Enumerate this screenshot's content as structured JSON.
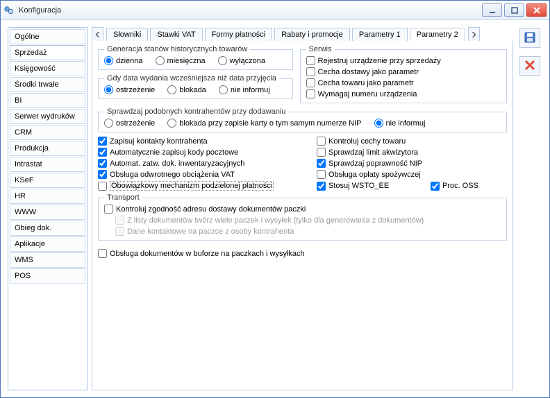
{
  "window": {
    "title": "Konfiguracja"
  },
  "sidebar": {
    "items": [
      {
        "label": "Ogólne"
      },
      {
        "label": "Sprzedaż",
        "selected": true
      },
      {
        "label": "Księgowość"
      },
      {
        "label": "Środki trwałe"
      },
      {
        "label": "BI"
      },
      {
        "label": "Serwer wydruków"
      },
      {
        "label": "CRM"
      },
      {
        "label": "Produkcja"
      },
      {
        "label": "Intrastat"
      },
      {
        "label": "KSeF"
      },
      {
        "label": "HR"
      },
      {
        "label": "WWW"
      },
      {
        "label": "Obieg dok."
      },
      {
        "label": "Aplikacje"
      },
      {
        "label": "WMS"
      },
      {
        "label": "POS"
      }
    ]
  },
  "tabs": [
    {
      "label": "Słowniki"
    },
    {
      "label": "Stawki VAT"
    },
    {
      "label": "Formy płatności"
    },
    {
      "label": "Rabaty i promocje"
    },
    {
      "label": "Parametry 1"
    },
    {
      "label": "Parametry 2",
      "active": true
    }
  ],
  "gen": {
    "legend": "Generacja stanów historycznych towarów",
    "opt1": "dzienna",
    "opt2": "miesięczna",
    "opt3": "wyłączona"
  },
  "serwis": {
    "legend": "Serwis",
    "c1": "Rejestruj urządzenie przy sprzedaży",
    "c2": "Cecha dostawy jako parametr",
    "c3": "Cecha towaru jako parametr",
    "c4": "Wymagaj numeru urządzenia"
  },
  "gdy": {
    "legend": "Gdy data wydania wcześniejsza niż data przyjęcia",
    "opt1": "ostrzeżenie",
    "opt2": "blokada",
    "opt3": "nie informuj"
  },
  "spr": {
    "legend": "Sprawdzaj podobnych kontrahentów przy dodawaniu",
    "opt1": "ostrzeżenie",
    "opt2": "blokada przy zapisie karty o tym samym numerze NIP",
    "opt3": "nie informuj"
  },
  "c": {
    "a1": "Zapisuj kontakty kontrahenta",
    "a2": "Automatycznie zapisuj kody pocztowe",
    "a3": "Automat. zatw. dok. inwentaryzacyjnych",
    "a4": "Obsługa odwrotnego obciążenia VAT",
    "a5": "Obowiązkowy mechanizm podzielonej płatności",
    "b1": "Kontroluj cechy towaru",
    "b2": "Sprawdzaj limit akwizytora",
    "b3": "Sprawdzaj poprawność NIP",
    "b4": "Obsługa opłaty spożywczej",
    "b5": "Stosuj WSTO_EE",
    "b6": "Proc. OSS"
  },
  "transport": {
    "legend": "Transport",
    "c1": "Kontroluj zgodność adresu dostawy dokumentów paczki",
    "c2": "Z listy dokumentów twórz wiele paczek i wysyłek (tylko dla generowania z dokumentów)",
    "c3": "Dane kontaktowe na paczce z osoby kontrahenta"
  },
  "after": "Obsługa dokumentów w buforze na paczkach i wysyłkach"
}
